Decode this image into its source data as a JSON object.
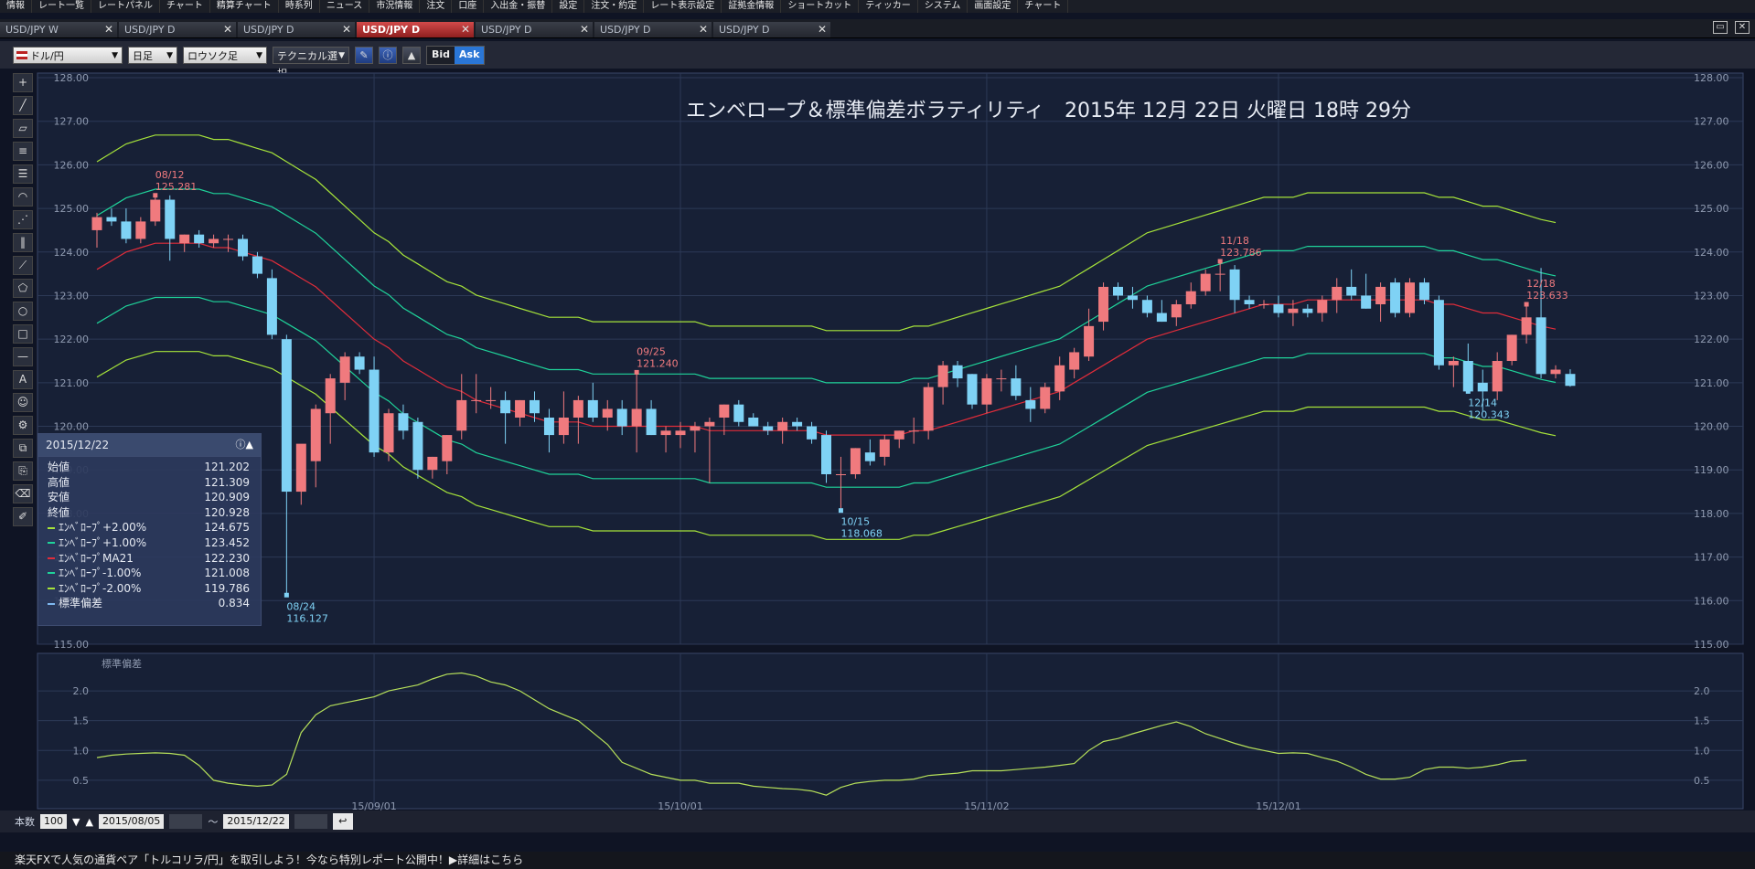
{
  "menu": [
    "情報",
    "レート一覧",
    "レートパネル",
    "チャート",
    "精算チャート",
    "時系列",
    "ニュース",
    "市況情報",
    "注文",
    "口座",
    "入出金・振替",
    "設定",
    "注文・約定",
    "レート表示設定",
    "証拠金情報",
    "ショートカット",
    "ティッカー",
    "システム",
    "画面設定",
    "チャート"
  ],
  "tabs": [
    "USD/JPY W",
    "USD/JPY D",
    "USD/JPY D",
    "USD/JPY D",
    "USD/JPY D",
    "USD/JPY D",
    "USD/JPY D"
  ],
  "active_tab": 3,
  "toolbar": {
    "pair": "ドル/円",
    "period": "日足",
    "chart_type": "ロウソク足",
    "technical": "テクニカル選択",
    "bid": "Bid",
    "ask": "Ask"
  },
  "chart_data": {
    "type": "candlestick",
    "title": "エンベロープ＆標準偏差ボラティリティ　2015年 12月 22日 火曜日 18時 29分",
    "ylim": [
      115,
      128
    ],
    "yticks": [
      "128.00",
      "127.00",
      "126.00",
      "125.00",
      "124.00",
      "123.00",
      "122.00",
      "121.00",
      "120.00",
      "119.00",
      "118.00",
      "117.00",
      "116.00",
      "115.00"
    ],
    "xticks": [
      {
        "label": "15/09/01",
        "index": 19
      },
      {
        "label": "15/10/01",
        "index": 40
      },
      {
        "label": "15/11/02",
        "index": 61
      },
      {
        "label": "15/12/01",
        "index": 81
      }
    ],
    "colors": {
      "up": "#f07a7e",
      "down": "#7fd2f5",
      "ma": "#e02c3a",
      "env1": "#1fd39a",
      "env2": "#a6e33a",
      "sd": "#b6e05a"
    },
    "candles": [
      [
        124.5,
        124.9,
        124.1,
        124.8
      ],
      [
        124.8,
        125.0,
        124.6,
        124.7
      ],
      [
        124.7,
        125.0,
        124.2,
        124.3
      ],
      [
        124.3,
        124.8,
        124.2,
        124.7
      ],
      [
        124.7,
        125.3,
        124.6,
        125.2
      ],
      [
        125.2,
        125.3,
        123.8,
        124.3
      ],
      [
        124.2,
        124.4,
        124.0,
        124.4
      ],
      [
        124.4,
        124.5,
        124.1,
        124.2
      ],
      [
        124.2,
        124.4,
        124.1,
        124.3
      ],
      [
        124.3,
        124.4,
        124.0,
        124.3
      ],
      [
        124.3,
        124.4,
        123.8,
        123.9
      ],
      [
        123.9,
        124.0,
        123.4,
        123.5
      ],
      [
        123.4,
        123.6,
        122.0,
        122.1
      ],
      [
        122.0,
        122.1,
        116.127,
        118.5
      ],
      [
        118.5,
        119.1,
        118.2,
        119.6
      ],
      [
        119.2,
        120.5,
        118.6,
        120.4
      ],
      [
        120.3,
        121.2,
        119.6,
        121.1
      ],
      [
        121.0,
        121.7,
        120.6,
        121.6
      ],
      [
        121.6,
        121.7,
        121.2,
        121.3
      ],
      [
        121.3,
        121.6,
        119.3,
        119.4
      ],
      [
        119.4,
        120.4,
        119.2,
        120.3
      ],
      [
        120.3,
        120.5,
        119.7,
        119.9
      ],
      [
        120.1,
        120.2,
        118.8,
        119.0
      ],
      [
        119.0,
        119.3,
        118.8,
        119.3
      ],
      [
        119.2,
        119.8,
        118.9,
        119.8
      ],
      [
        119.9,
        121.2,
        119.7,
        120.6
      ],
      [
        120.6,
        121.2,
        120.3,
        120.6
      ],
      [
        120.6,
        120.9,
        120.4,
        120.6
      ],
      [
        120.6,
        120.8,
        119.6,
        120.3
      ],
      [
        120.2,
        120.6,
        120.0,
        120.6
      ],
      [
        120.6,
        120.8,
        120.1,
        120.3
      ],
      [
        120.2,
        120.4,
        119.4,
        119.8
      ],
      [
        119.8,
        120.8,
        119.6,
        120.2
      ],
      [
        120.2,
        120.7,
        119.6,
        120.6
      ],
      [
        120.6,
        121.0,
        120.1,
        120.2
      ],
      [
        120.2,
        120.6,
        119.9,
        120.4
      ],
      [
        120.4,
        120.6,
        119.8,
        120.0
      ],
      [
        120.0,
        121.24,
        119.4,
        120.4
      ],
      [
        120.4,
        120.6,
        119.8,
        119.8
      ],
      [
        119.8,
        120.0,
        119.4,
        119.9
      ],
      [
        119.8,
        120.1,
        119.5,
        119.9
      ],
      [
        119.9,
        120.1,
        119.4,
        120.0
      ],
      [
        120.0,
        120.2,
        118.7,
        120.1
      ],
      [
        120.2,
        120.5,
        119.8,
        120.5
      ],
      [
        120.5,
        120.6,
        120.0,
        120.1
      ],
      [
        120.2,
        120.3,
        120.0,
        120.0
      ],
      [
        120.0,
        120.1,
        119.8,
        119.9
      ],
      [
        119.9,
        120.2,
        119.6,
        120.1
      ],
      [
        120.1,
        120.2,
        119.9,
        120.0
      ],
      [
        120.0,
        120.1,
        119.6,
        119.7
      ],
      [
        119.8,
        119.9,
        118.7,
        118.9
      ],
      [
        118.9,
        119.3,
        118.068,
        118.9
      ],
      [
        118.9,
        119.5,
        118.8,
        119.5
      ],
      [
        119.4,
        119.7,
        119.1,
        119.2
      ],
      [
        119.3,
        119.8,
        119.1,
        119.7
      ],
      [
        119.7,
        119.9,
        119.5,
        119.9
      ],
      [
        119.9,
        120.2,
        119.6,
        119.9
      ],
      [
        119.9,
        121.0,
        119.7,
        120.9
      ],
      [
        120.9,
        121.5,
        120.5,
        121.4
      ],
      [
        121.4,
        121.5,
        120.9,
        121.1
      ],
      [
        121.2,
        121.2,
        120.4,
        120.5
      ],
      [
        120.5,
        121.2,
        120.3,
        121.1
      ],
      [
        121.1,
        121.3,
        120.8,
        121.1
      ],
      [
        121.1,
        121.4,
        120.6,
        120.7
      ],
      [
        120.6,
        120.9,
        120.1,
        120.4
      ],
      [
        120.4,
        121.0,
        120.3,
        120.9
      ],
      [
        120.8,
        121.6,
        120.6,
        121.4
      ],
      [
        121.3,
        121.8,
        121.1,
        121.7
      ],
      [
        121.6,
        122.7,
        121.5,
        122.3
      ],
      [
        122.4,
        123.3,
        122.2,
        123.2
      ],
      [
        123.2,
        123.3,
        122.9,
        123.0
      ],
      [
        123.0,
        123.2,
        122.7,
        122.9
      ],
      [
        122.9,
        123.0,
        122.5,
        122.6
      ],
      [
        122.6,
        122.9,
        122.4,
        122.4
      ],
      [
        122.5,
        122.9,
        122.3,
        122.8
      ],
      [
        122.8,
        123.3,
        122.7,
        123.1
      ],
      [
        123.1,
        123.6,
        123.0,
        123.5
      ],
      [
        123.5,
        123.786,
        123.1,
        123.5
      ],
      [
        123.6,
        123.7,
        122.6,
        122.9
      ],
      [
        122.9,
        123.0,
        122.7,
        122.8
      ],
      [
        122.8,
        122.9,
        122.7,
        122.8
      ],
      [
        122.8,
        123.0,
        122.5,
        122.6
      ],
      [
        122.6,
        122.9,
        122.3,
        122.7
      ],
      [
        122.7,
        122.8,
        122.5,
        122.6
      ],
      [
        122.6,
        123.0,
        122.4,
        122.9
      ],
      [
        122.9,
        123.4,
        122.6,
        123.2
      ],
      [
        123.2,
        123.6,
        122.9,
        123.0
      ],
      [
        123.0,
        123.5,
        122.7,
        122.7
      ],
      [
        122.8,
        123.3,
        122.4,
        123.2
      ],
      [
        123.3,
        123.4,
        122.5,
        122.6
      ],
      [
        122.6,
        123.4,
        122.5,
        123.3
      ],
      [
        123.3,
        123.4,
        122.8,
        122.9
      ],
      [
        122.9,
        123.0,
        121.3,
        121.4
      ],
      [
        121.4,
        121.6,
        120.9,
        121.5
      ],
      [
        121.5,
        121.9,
        120.8,
        120.8
      ],
      [
        121.0,
        121.3,
        120.343,
        120.8
      ],
      [
        120.8,
        121.7,
        120.6,
        121.5
      ],
      [
        121.5,
        122.1,
        121.4,
        122.1
      ],
      [
        122.1,
        122.8,
        121.9,
        122.5
      ],
      [
        122.5,
        123.633,
        121.1,
        121.2
      ],
      [
        121.2,
        121.4,
        121.1,
        121.3
      ],
      [
        121.202,
        121.309,
        120.909,
        120.928
      ]
    ],
    "ma21": [
      123.6,
      123.8,
      124.0,
      124.1,
      124.2,
      124.2,
      124.2,
      124.2,
      124.1,
      124.1,
      124.0,
      123.9,
      123.8,
      123.6,
      123.4,
      123.2,
      122.9,
      122.6,
      122.3,
      122.0,
      121.8,
      121.5,
      121.3,
      121.1,
      120.9,
      120.8,
      120.6,
      120.5,
      120.4,
      120.3,
      120.2,
      120.1,
      120.1,
      120.1,
      120.0,
      120.0,
      120.0,
      120.0,
      120.0,
      120.0,
      120.0,
      120.0,
      119.9,
      119.9,
      119.9,
      119.9,
      119.9,
      119.9,
      119.9,
      119.9,
      119.8,
      119.8,
      119.8,
      119.8,
      119.8,
      119.8,
      119.9,
      119.9,
      120.0,
      120.1,
      120.2,
      120.3,
      120.4,
      120.5,
      120.6,
      120.7,
      120.8,
      121.0,
      121.2,
      121.4,
      121.6,
      121.8,
      122.0,
      122.1,
      122.2,
      122.3,
      122.4,
      122.5,
      122.6,
      122.7,
      122.8,
      122.8,
      122.8,
      122.9,
      122.9,
      122.9,
      122.9,
      122.9,
      122.9,
      122.9,
      122.9,
      122.9,
      122.8,
      122.8,
      122.7,
      122.6,
      122.6,
      122.5,
      122.4,
      122.3,
      122.23
    ],
    "sd": [
      0.88,
      0.92,
      0.94,
      0.95,
      0.96,
      0.95,
      0.92,
      0.75,
      0.5,
      0.45,
      0.42,
      0.4,
      0.42,
      0.6,
      1.3,
      1.6,
      1.75,
      1.8,
      1.85,
      1.9,
      2.0,
      2.05,
      2.1,
      2.2,
      2.28,
      2.3,
      2.25,
      2.15,
      2.1,
      2.0,
      1.85,
      1.7,
      1.6,
      1.5,
      1.3,
      1.1,
      0.8,
      0.7,
      0.6,
      0.55,
      0.5,
      0.5,
      0.45,
      0.45,
      0.45,
      0.4,
      0.38,
      0.36,
      0.35,
      0.32,
      0.25,
      0.38,
      0.45,
      0.48,
      0.5,
      0.5,
      0.52,
      0.58,
      0.6,
      0.62,
      0.66,
      0.66,
      0.66,
      0.68,
      0.7,
      0.72,
      0.75,
      0.78,
      1.0,
      1.15,
      1.2,
      1.28,
      1.35,
      1.42,
      1.48,
      1.4,
      1.28,
      1.2,
      1.12,
      1.05,
      1.0,
      0.95,
      0.96,
      0.95,
      0.88,
      0.82,
      0.72,
      0.6,
      0.52,
      0.52,
      0.55,
      0.68,
      0.72,
      0.72,
      0.7,
      0.72,
      0.76,
      0.82,
      0.834
    ],
    "sd_ylim": [
      0.2,
      2.4
    ],
    "sd_yticks": [
      "2.0",
      "1.5",
      "1.0",
      "0.5"
    ],
    "sd_label": "標準偏差",
    "annotations": [
      {
        "index": 4,
        "date": "08/12",
        "value": "125.281",
        "kind": "high"
      },
      {
        "index": 13,
        "date": "08/24",
        "value": "116.127",
        "kind": "low"
      },
      {
        "index": 37,
        "date": "09/25",
        "value": "121.240",
        "kind": "high"
      },
      {
        "index": 51,
        "date": "10/15",
        "value": "118.068",
        "kind": "low"
      },
      {
        "index": 77,
        "date": "11/18",
        "value": "123.786",
        "kind": "high"
      },
      {
        "index": 94,
        "date": "12/14",
        "value": "120.343",
        "kind": "low"
      },
      {
        "index": 98,
        "date": "12/18",
        "value": "123.633",
        "kind": "high"
      }
    ]
  },
  "info_panel": {
    "date": "2015/12/22",
    "rows": [
      {
        "name": "始値",
        "value": "121.202",
        "color": ""
      },
      {
        "name": "高値",
        "value": "121.309",
        "color": ""
      },
      {
        "name": "安値",
        "value": "120.909",
        "color": ""
      },
      {
        "name": "終値",
        "value": "120.928",
        "color": ""
      },
      {
        "name": "ｴﾝﾍﾞﾛｰﾌﾟ+2.00%",
        "value": "124.675",
        "color": "#a6e33a"
      },
      {
        "name": "ｴﾝﾍﾞﾛｰﾌﾟ+1.00%",
        "value": "123.452",
        "color": "#1fd39a"
      },
      {
        "name": "ｴﾝﾍﾞﾛｰﾌﾟMA21",
        "value": "122.230",
        "color": "#e02c3a"
      },
      {
        "name": "ｴﾝﾍﾞﾛｰﾌﾟ-1.00%",
        "value": "121.008",
        "color": "#1fd39a"
      },
      {
        "name": "ｴﾝﾍﾞﾛｰﾌﾟ-2.00%",
        "value": "119.786",
        "color": "#a6e33a"
      },
      {
        "name": "標準偏差",
        "value": "0.834",
        "color": "#7fb8f0"
      }
    ]
  },
  "bottom": {
    "count_label": "本数",
    "count": "100",
    "from_date": "2015/08/05",
    "tilde": "〜",
    "to_date": "2015/12/22"
  },
  "ticker": "楽天FXで人気の通貨ペア「トルコリラ/円」を取引しよう！今なら特別レポート公開中！▶詳細はこちら"
}
